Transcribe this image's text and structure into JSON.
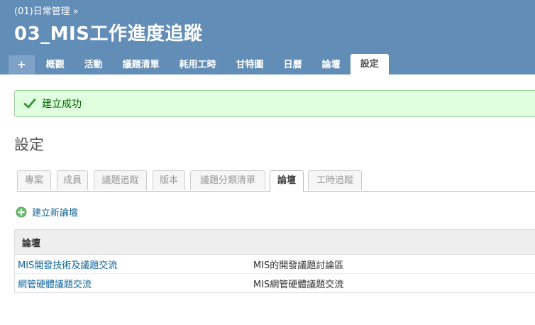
{
  "header": {
    "breadcrumb_parent": "(01)日常管理",
    "breadcrumb_sep": "»",
    "project_title": "03_MIS工作進度追蹤"
  },
  "main_menu": {
    "plus": "+",
    "tabs": [
      "概觀",
      "活動",
      "議題清單",
      "耗用工時",
      "甘特圖",
      "日曆",
      "論壇",
      "設定"
    ],
    "selected": "設定"
  },
  "flash": {
    "message": "建立成功"
  },
  "page": {
    "heading": "設定"
  },
  "settings_tabs": {
    "items": [
      "專案",
      "成員",
      "議題追蹤",
      "版本",
      "議題分類清單",
      "論壇",
      "工時追蹤"
    ],
    "active": "論壇"
  },
  "actions": {
    "new_board": "建立新論壇"
  },
  "boards_table": {
    "header": "論壇",
    "rows": [
      {
        "name": "MIS開發技術及議題交流",
        "description": "MIS的開發議題討論區"
      },
      {
        "name": "網管硬體議題交流",
        "description": "MIS網管硬體議題交流"
      }
    ]
  },
  "colors": {
    "header_bg": "#628db6",
    "flash_bg": "#dfffdf",
    "flash_border": "#9fcf9f",
    "link": "#116699",
    "success_icon": "#3c9a3c",
    "add_icon": "#54a054"
  }
}
